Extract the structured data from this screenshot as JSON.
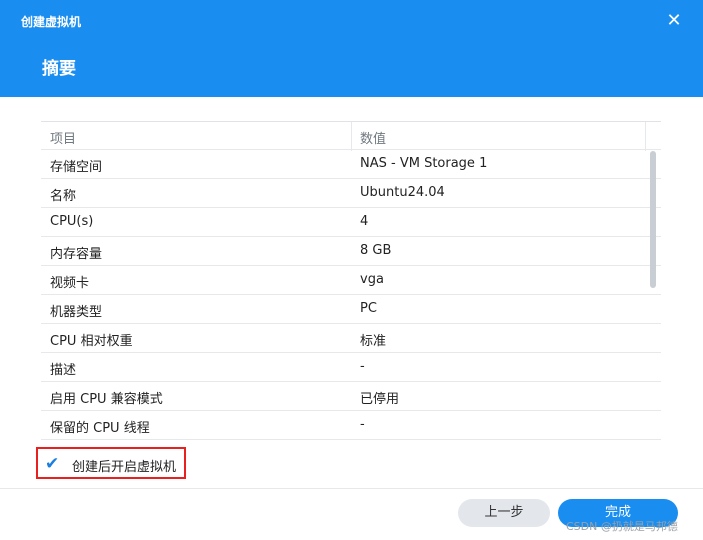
{
  "window": {
    "title": "创建虚拟机",
    "step_title": "摘要",
    "close_glyph": "✕"
  },
  "table": {
    "headers": [
      "项目",
      "数值"
    ],
    "rows": [
      [
        "存储空间",
        "NAS - VM Storage 1"
      ],
      [
        "名称",
        "Ubuntu24.04"
      ],
      [
        "CPU(s)",
        "4"
      ],
      [
        "内存容量",
        "8 GB"
      ],
      [
        "视频卡",
        "vga"
      ],
      [
        "机器类型",
        "PC"
      ],
      [
        "CPU 相对权重",
        "标准"
      ],
      [
        "描述",
        "-"
      ],
      [
        "启用 CPU 兼容模式",
        "已停用"
      ],
      [
        "保留的 CPU 线程",
        "-"
      ]
    ]
  },
  "options": {
    "start_after_create_label": "创建后开启虚拟机",
    "start_after_create_checked": true
  },
  "footer": {
    "back_label": "上一步",
    "done_label": "完成"
  },
  "watermark": "CSDN @扔就是马邦德",
  "colors": {
    "accent": "#1a8ef0",
    "highlight_border": "#e8211f"
  }
}
